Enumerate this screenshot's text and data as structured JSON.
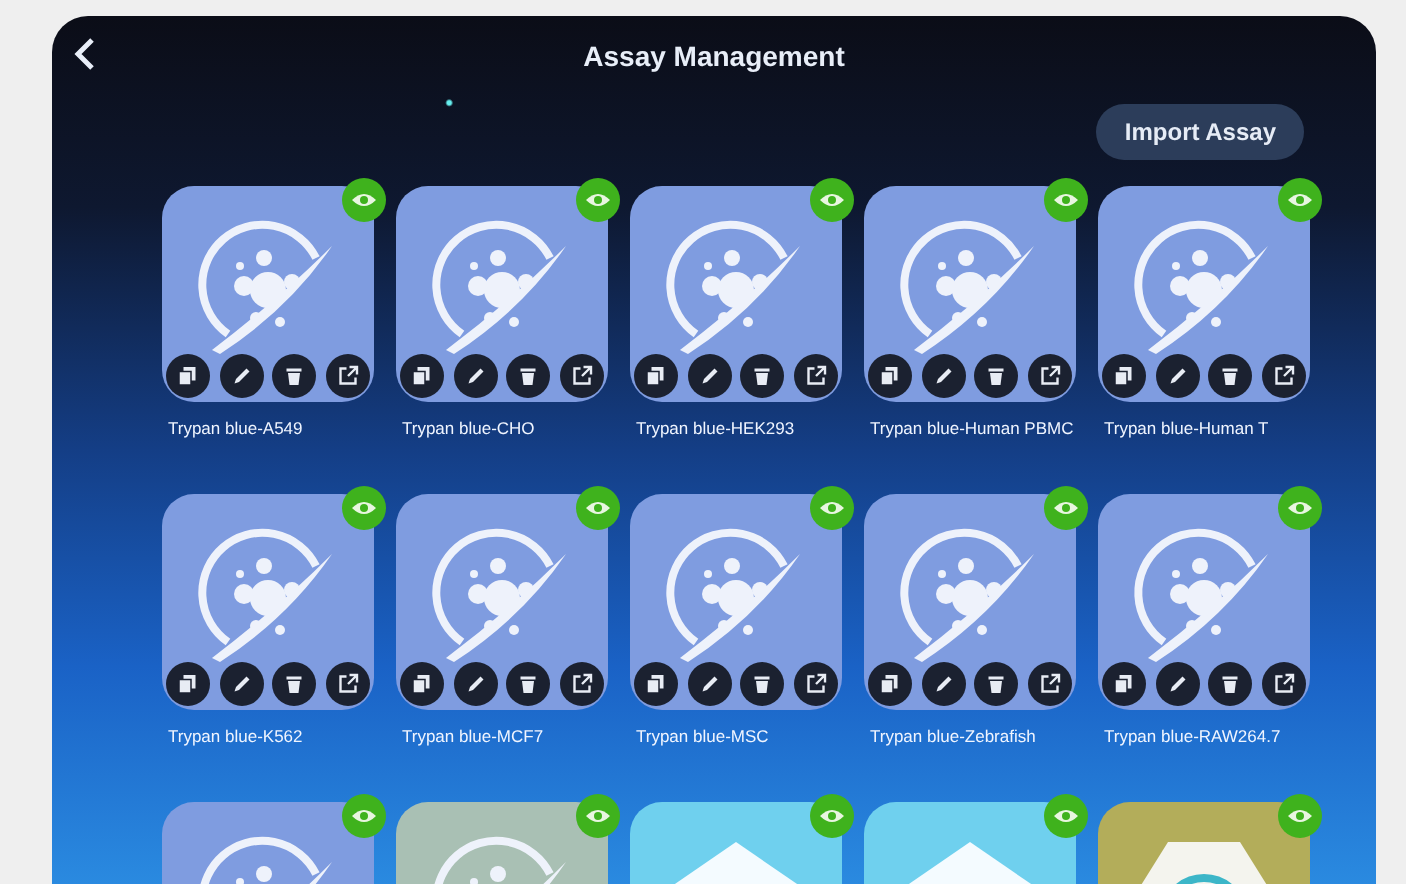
{
  "header": {
    "title": "Assay Management",
    "import_button": "Import Assay"
  },
  "rows": [
    {
      "tiles": [
        {
          "label": "Trypan blue-A549",
          "kind": "cell",
          "color": "#7f9ce0"
        },
        {
          "label": "Trypan blue-CHO",
          "kind": "cell",
          "color": "#7f9ce0"
        },
        {
          "label": "Trypan blue-HEK293",
          "kind": "cell",
          "color": "#7f9ce0"
        },
        {
          "label": "Trypan blue-Human PBMC",
          "kind": "cell",
          "color": "#7f9ce0"
        },
        {
          "label": "Trypan blue-Human T",
          "kind": "cell",
          "color": "#7f9ce0"
        }
      ]
    },
    {
      "tiles": [
        {
          "label": "Trypan blue-K562",
          "kind": "cell",
          "color": "#7f9ce0"
        },
        {
          "label": "Trypan blue-MCF7",
          "kind": "cell",
          "color": "#7f9ce0"
        },
        {
          "label": "Trypan blue-MSC",
          "kind": "cell",
          "color": "#7f9ce0"
        },
        {
          "label": "Trypan blue-Zebrafish",
          "kind": "cell",
          "color": "#7f9ce0"
        },
        {
          "label": "Trypan blue-RAW264.7",
          "kind": "cell",
          "color": "#7f9ce0"
        }
      ]
    },
    {
      "tiles": [
        {
          "kind": "cell",
          "color": "#7f9ce0"
        },
        {
          "kind": "cell",
          "color": "#a9c0b4"
        },
        {
          "kind": "chart",
          "color": "#6fd0ee"
        },
        {
          "kind": "chart",
          "color": "#6fd0ee"
        },
        {
          "kind": "cell-hex",
          "color": "#b3ad5a"
        }
      ]
    }
  ]
}
